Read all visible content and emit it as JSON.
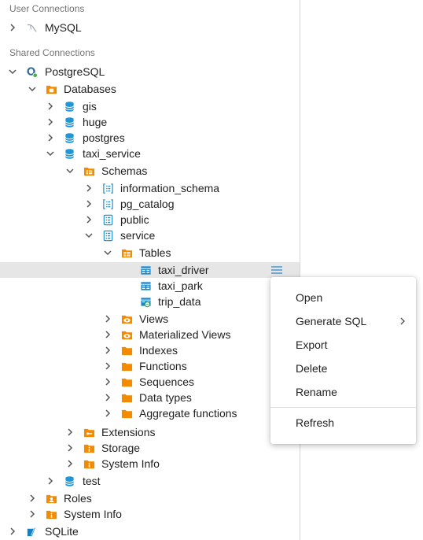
{
  "sections": {
    "user": "User Connections",
    "shared": "Shared Connections"
  },
  "tree": {
    "mysql": "MySQL",
    "postgresql": "PostgreSQL",
    "databases": "Databases",
    "gis": "gis",
    "huge": "huge",
    "postgres": "postgres",
    "taxi_service": "taxi_service",
    "schemas": "Schemas",
    "information_schema": "information_schema",
    "pg_catalog": "pg_catalog",
    "public": "public",
    "service": "service",
    "tables": "Tables",
    "taxi_driver": "taxi_driver",
    "taxi_park": "taxi_park",
    "trip_data": "trip_data",
    "views": "Views",
    "materialized_views": "Materialized Views",
    "indexes": "Indexes",
    "functions": "Functions",
    "sequences": "Sequences",
    "data_types": "Data types",
    "aggregate_functions": "Aggregate functions",
    "extensions": "Extensions",
    "storage": "Storage",
    "system_info_db": "System Info",
    "test": "test",
    "roles": "Roles",
    "system_info": "System Info",
    "sqlite": "SQLite"
  },
  "context_menu": {
    "open": "Open",
    "generate_sql": "Generate SQL",
    "export": "Export",
    "delete": "Delete",
    "rename": "Rename",
    "refresh": "Refresh"
  },
  "colors": {
    "db_blue": "#2196d3",
    "folder_orange": "#f48a00",
    "table_blue": "#1f87c8",
    "selected_row": "#e6e6e6",
    "text": "#212121",
    "section_gray": "#757575"
  }
}
